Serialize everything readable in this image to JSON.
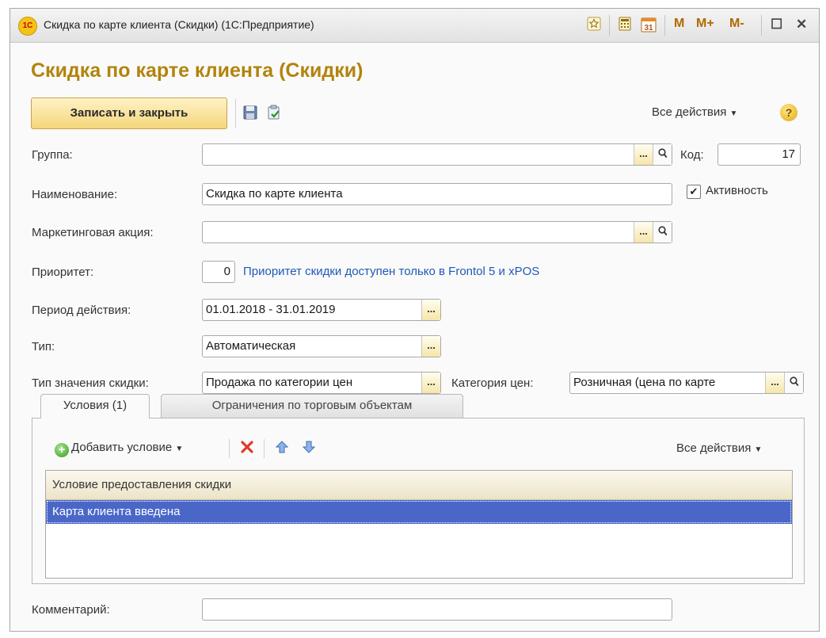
{
  "window": {
    "title": "Скидка по карте клиента (Скидки)  (1С:Предприятие)",
    "logo_text": "1С",
    "toolbar_icons": [
      "star-icon",
      "calculator-icon",
      "calendar-icon"
    ],
    "calendar_day": "31",
    "memory_buttons": [
      "M",
      "M+",
      "M-"
    ],
    "maximize_glyph": "☐",
    "close_glyph": "✕"
  },
  "form": {
    "title": "Скидка по карте клиента (Скидки)",
    "save_close_label": "Записать и закрыть",
    "all_actions_label": "Все действия",
    "help_label": "?"
  },
  "fields": {
    "group_label": "Группа:",
    "group_value": "",
    "code_label": "Код:",
    "code_value": "17",
    "name_label": "Наименование:",
    "name_value": "Скидка по карте клиента",
    "active_label": "Активность",
    "active_checked": true,
    "marketing_label": "Маркетинговая акция:",
    "marketing_value": "",
    "priority_label": "Приоритет:",
    "priority_value": "0",
    "priority_note": "Приоритет скидки доступен только в Frontol 5 и xPOS",
    "period_label": "Период действия:",
    "period_value": "01.01.2018 - 31.01.2019",
    "type_label": "Тип:",
    "type_value": "Автоматическая",
    "value_type_label": "Тип значения скидки:",
    "value_type_value": "Продажа по категории цен",
    "price_category_label": "Категория цен:",
    "price_category_value": "Розничная (цена по карте",
    "comment_label": "Комментарий:",
    "comment_value": ""
  },
  "tabs": [
    {
      "label": "Условия (1)",
      "active": true
    },
    {
      "label": "Ограничения по торговым объектам",
      "active": false
    }
  ],
  "conditions": {
    "add_label": "Добавить условие",
    "all_actions_label": "Все действия",
    "column_header": "Условие предоставления скидки",
    "rows": [
      "Карта клиента введена"
    ]
  },
  "colors": {
    "title": "#b2840d",
    "link": "#1f59b8",
    "selected_row": "#4a67c8",
    "delete_icon": "#e03a2a"
  }
}
